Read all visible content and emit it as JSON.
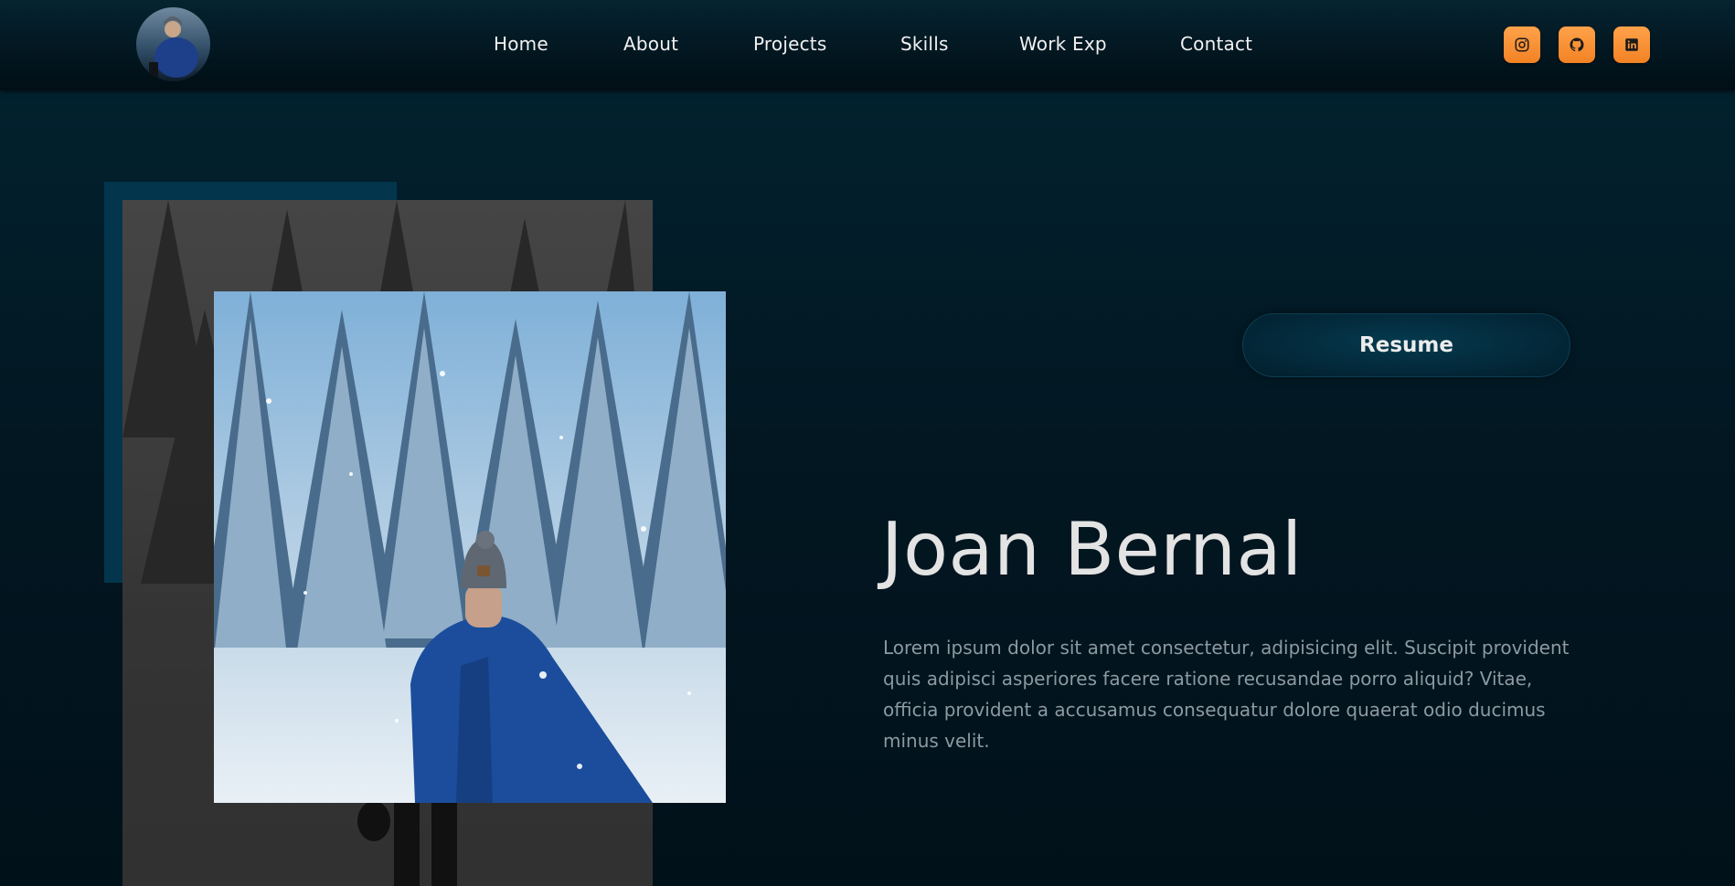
{
  "header": {
    "avatar_alt": "Joan Bernal avatar",
    "nav": [
      {
        "label": "Home"
      },
      {
        "label": "About"
      },
      {
        "label": "Projects"
      },
      {
        "label": "Skills"
      },
      {
        "label": "Work Exp"
      },
      {
        "label": "Contact"
      }
    ],
    "social": [
      {
        "icon": "instagram-icon"
      },
      {
        "icon": "github-icon"
      },
      {
        "icon": "linkedin-icon"
      }
    ]
  },
  "hero": {
    "resume_label": "Resume",
    "name": "Joan Bernal",
    "description": "Lorem ipsum dolor sit amet consectetur, adipisicing elit. Suscipit provident quis adipisci asperiores facere ratione recusandae porro aliquid? Vitae, officia provident a accusamus consequatur dolore quaerat odio ducimus minus velit."
  },
  "colors": {
    "background": "#021722",
    "accent": "#f28224",
    "block": "#03364c"
  }
}
